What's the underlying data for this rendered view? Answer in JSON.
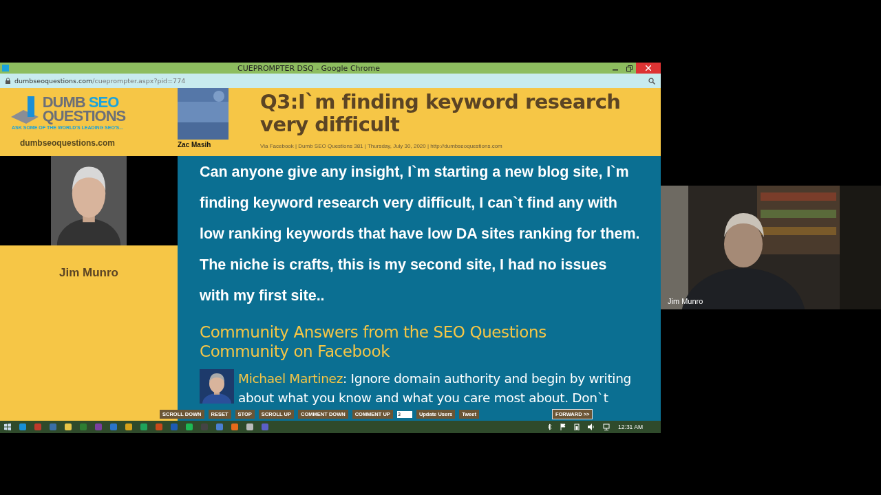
{
  "browser": {
    "title": "CUEPROMPTER DSQ - Google Chrome",
    "url_host": "dumbseoquestions.com",
    "url_path": "/cueprompter.aspx?pid=774"
  },
  "header": {
    "logo_line1_a": "DUMB",
    "logo_line1_b": "SEO",
    "logo_line2": "QUESTIONS",
    "tagline": "ASK SOME OF THE WORLD'S LEADING SEO'S...",
    "site": "dumbseoquestions.com",
    "asker": "Zac Masih",
    "question": "Q3:I`m finding keyword research very difficult",
    "meta": "Via Facebook | Dumb SEO Questions 381 | Thursday, July 30, 2020 | http://dumbseoquestions.com"
  },
  "panelist": {
    "name": "Jim Munro"
  },
  "question_body": "Can anyone give any insight, I`m starting a new blog site, I`m finding keyword research very difficult, I can`t find any with low ranking keywords that have low DA sites ranking for them. The niche is crafts, this is my second site, I had no issues with my first site..",
  "answers_heading": "Community Answers from the SEO Questions Community on Facebook",
  "answer": {
    "author": "Michael Martinez",
    "text": ": Ignore domain authority and begin by writing about what you know and what you care most about. Don`t"
  },
  "controls": [
    {
      "label": "SCROLL DOWN",
      "kind": "button"
    },
    {
      "label": "RESET",
      "kind": "button"
    },
    {
      "label": "STOP",
      "kind": "button"
    },
    {
      "label": "SCROLL UP",
      "kind": "button"
    },
    {
      "label": "COMMENT DOWN",
      "kind": "button"
    },
    {
      "label": "COMMENT UP",
      "kind": "button"
    },
    {
      "value": "3",
      "kind": "input"
    },
    {
      "label": "Update Users",
      "kind": "button"
    },
    {
      "label": "Tweet",
      "kind": "button"
    },
    {
      "label": "FORWARD >>",
      "kind": "forward"
    }
  ],
  "taskbar": {
    "clock": "12:31 AM"
  },
  "video": {
    "name": "Jim Munro"
  }
}
